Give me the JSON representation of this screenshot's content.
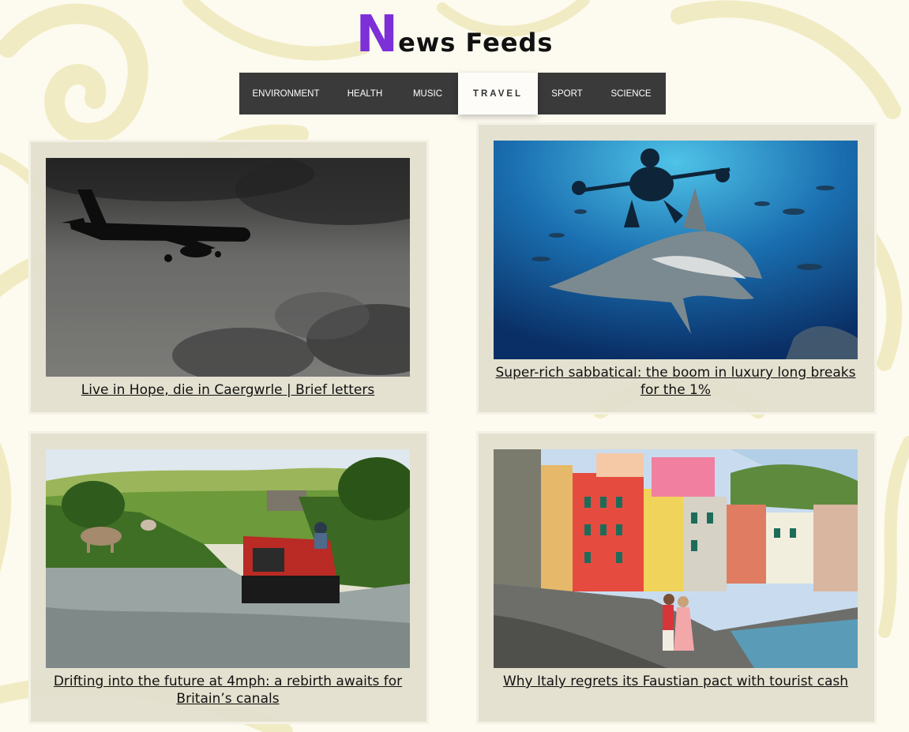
{
  "header": {
    "title_initial": "N",
    "title_rest": "ews Feeds"
  },
  "nav": {
    "items": [
      "ENVIRONMENT",
      "HEALTH",
      "MUSIC",
      "TRAVEL",
      "SPORT",
      "SCIENCE"
    ],
    "active": "TRAVEL"
  },
  "articles": [
    {
      "headline": "Live in Hope, die in Caergwrle | Brief letters"
    },
    {
      "headline": "Super-rich sabbatical: the boom in luxury long breaks for the 1%"
    },
    {
      "headline": "Drifting into the future at 4mph: a rebirth awaits for Britain’s canals"
    },
    {
      "headline": "Why Italy regrets its Faustian pact with tourist cash"
    }
  ],
  "colors": {
    "title_accent": "#7d2fd8",
    "nav_background": "#3a3a3a",
    "card_background": "#e2dfce",
    "page_background": "#fdfbef"
  }
}
